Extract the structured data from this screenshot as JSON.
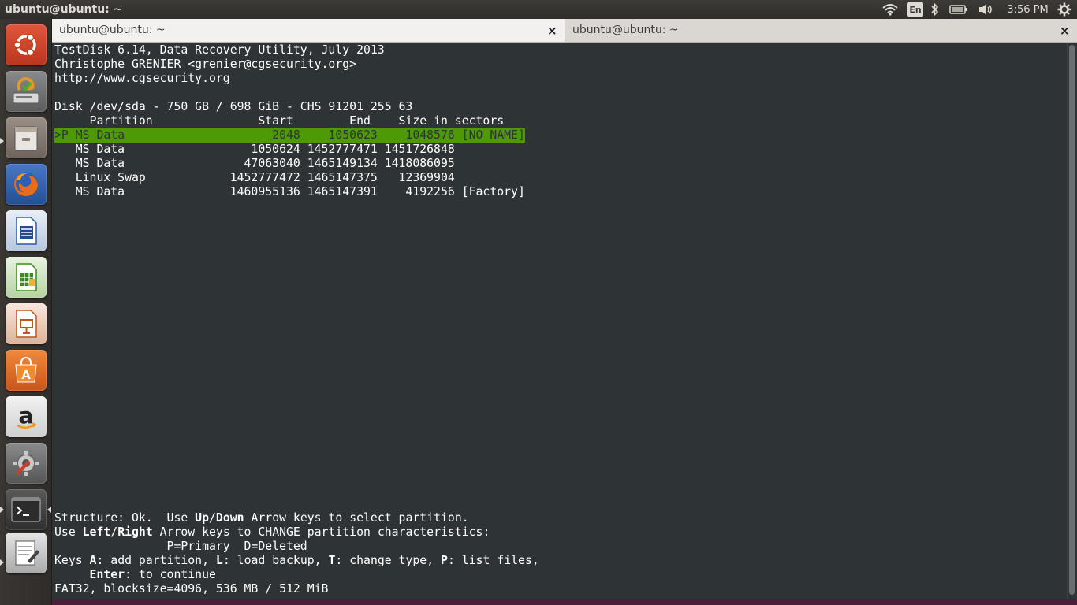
{
  "topbar": {
    "title": "ubuntu@ubuntu: ~",
    "keyboard": "En",
    "clock": "3:56 PM",
    "icons": [
      "wifi-icon",
      "keyboard-layout-icon",
      "bluetooth-icon",
      "battery-icon",
      "volume-icon",
      "clock",
      "settings-gear-icon"
    ]
  },
  "launcher": {
    "items": [
      "ubuntu-dash-icon",
      "backups-icon",
      "files-icon",
      "firefox-icon",
      "writer-icon",
      "calc-icon",
      "impress-icon",
      "software-center-icon",
      "amazon-icon",
      "system-settings-icon",
      "terminal-icon",
      "text-editor-icon"
    ]
  },
  "tabs": [
    {
      "label": "ubuntu@ubuntu: ~",
      "close": "×"
    },
    {
      "label": "ubuntu@ubuntu: ~",
      "close": "×"
    }
  ],
  "terminal": {
    "header": [
      "TestDisk 6.14, Data Recovery Utility, July 2013",
      "Christophe GRENIER <grenier@cgsecurity.org>",
      "http://www.cgsecurity.org"
    ],
    "disk": "Disk /dev/sda - 750 GB / 698 GiB - CHS 91201 255 63",
    "columns": "     Partition               Start        End    Size in sectors",
    "rows": [
      ">P MS Data                     2048    1050623    1048576 [NO NAME]",
      "   MS Data                  1050624 1452777471 1451726848",
      "   MS Data                 47063040 1465149134 1418086095",
      "   Linux Swap            1452777472 1465147375   12369904",
      "   MS Data               1460955136 1465147391    4192256 [Factory]"
    ],
    "footer": {
      "l1_a": "Structure: Ok.  Use ",
      "l1_b": "Up",
      "l1_c": "/",
      "l1_d": "Down",
      "l1_e": " Arrow keys to select partition.",
      "l2_a": "Use ",
      "l2_b": "Left",
      "l2_c": "/",
      "l2_d": "Right",
      "l2_e": " Arrow keys to CHANGE partition characteristics:",
      "l3": "                P=Primary  D=Deleted",
      "l4_a": "Keys ",
      "l4_b": "A",
      "l4_c": ": add partition, ",
      "l4_d": "L",
      "l4_e": ": load backup, ",
      "l4_f": "T",
      "l4_g": ": change type, ",
      "l4_h": "P",
      "l4_i": ": list files,",
      "l5_a": "     ",
      "l5_b": "Enter",
      "l5_c": ": to continue",
      "l6": "FAT32, blocksize=4096, 536 MB / 512 MiB"
    }
  },
  "colors": {
    "terminal_bg": "#2e3436",
    "highlight": "#4e9a06",
    "panel": "#3c3b37"
  }
}
